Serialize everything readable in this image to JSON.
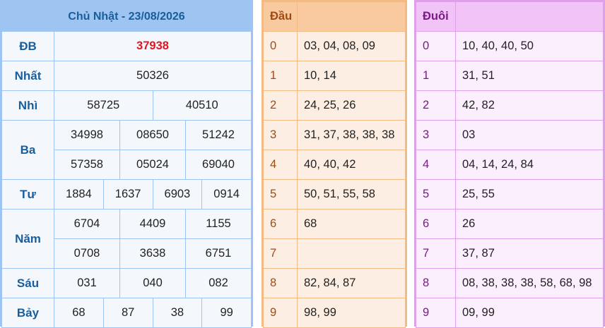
{
  "results": {
    "header": "Chủ Nhật - 23/08/2026",
    "rows": {
      "db": {
        "label": "ĐB",
        "values": [
          "37938"
        ]
      },
      "nhat": {
        "label": "Nhất",
        "values": [
          "50326"
        ]
      },
      "nhi": {
        "label": "Nhì",
        "values": [
          "58725",
          "40510"
        ]
      },
      "ba": {
        "label": "Ba",
        "values": [
          "34998",
          "08650",
          "51242",
          "57358",
          "05024",
          "69040"
        ]
      },
      "tu": {
        "label": "Tư",
        "values": [
          "1884",
          "1637",
          "6903",
          "0914"
        ]
      },
      "nam": {
        "label": "Năm",
        "values": [
          "6704",
          "4409",
          "1155",
          "0708",
          "3638",
          "6751"
        ]
      },
      "sau": {
        "label": "Sáu",
        "values": [
          "031",
          "040",
          "082"
        ]
      },
      "bay": {
        "label": "Bảy",
        "values": [
          "68",
          "87",
          "38",
          "99"
        ]
      }
    },
    "special_color": "#e0161f"
  },
  "dau": {
    "header": "Đầu",
    "rows": [
      {
        "k": "0",
        "v": "03, 04, 08, 09"
      },
      {
        "k": "1",
        "v": "10, 14"
      },
      {
        "k": "2",
        "v": "24, 25, 26"
      },
      {
        "k": "3",
        "v": "31, 37, 38, 38, 38"
      },
      {
        "k": "4",
        "v": "40, 40, 42"
      },
      {
        "k": "5",
        "v": "50, 51, 55, 58"
      },
      {
        "k": "6",
        "v": "68"
      },
      {
        "k": "7",
        "v": ""
      },
      {
        "k": "8",
        "v": "82, 84, 87"
      },
      {
        "k": "9",
        "v": "98, 99"
      }
    ]
  },
  "duoi": {
    "header": "Đuôi",
    "rows": [
      {
        "k": "0",
        "v": "10, 40, 40, 50"
      },
      {
        "k": "1",
        "v": "31, 51"
      },
      {
        "k": "2",
        "v": "42, 82"
      },
      {
        "k": "3",
        "v": "03"
      },
      {
        "k": "4",
        "v": "04, 14, 24, 84"
      },
      {
        "k": "5",
        "v": "25, 55"
      },
      {
        "k": "6",
        "v": "26"
      },
      {
        "k": "7",
        "v": "37, 87"
      },
      {
        "k": "8",
        "v": "08, 38, 38, 38, 58, 68, 98"
      },
      {
        "k": "9",
        "v": "09, 99"
      }
    ]
  }
}
